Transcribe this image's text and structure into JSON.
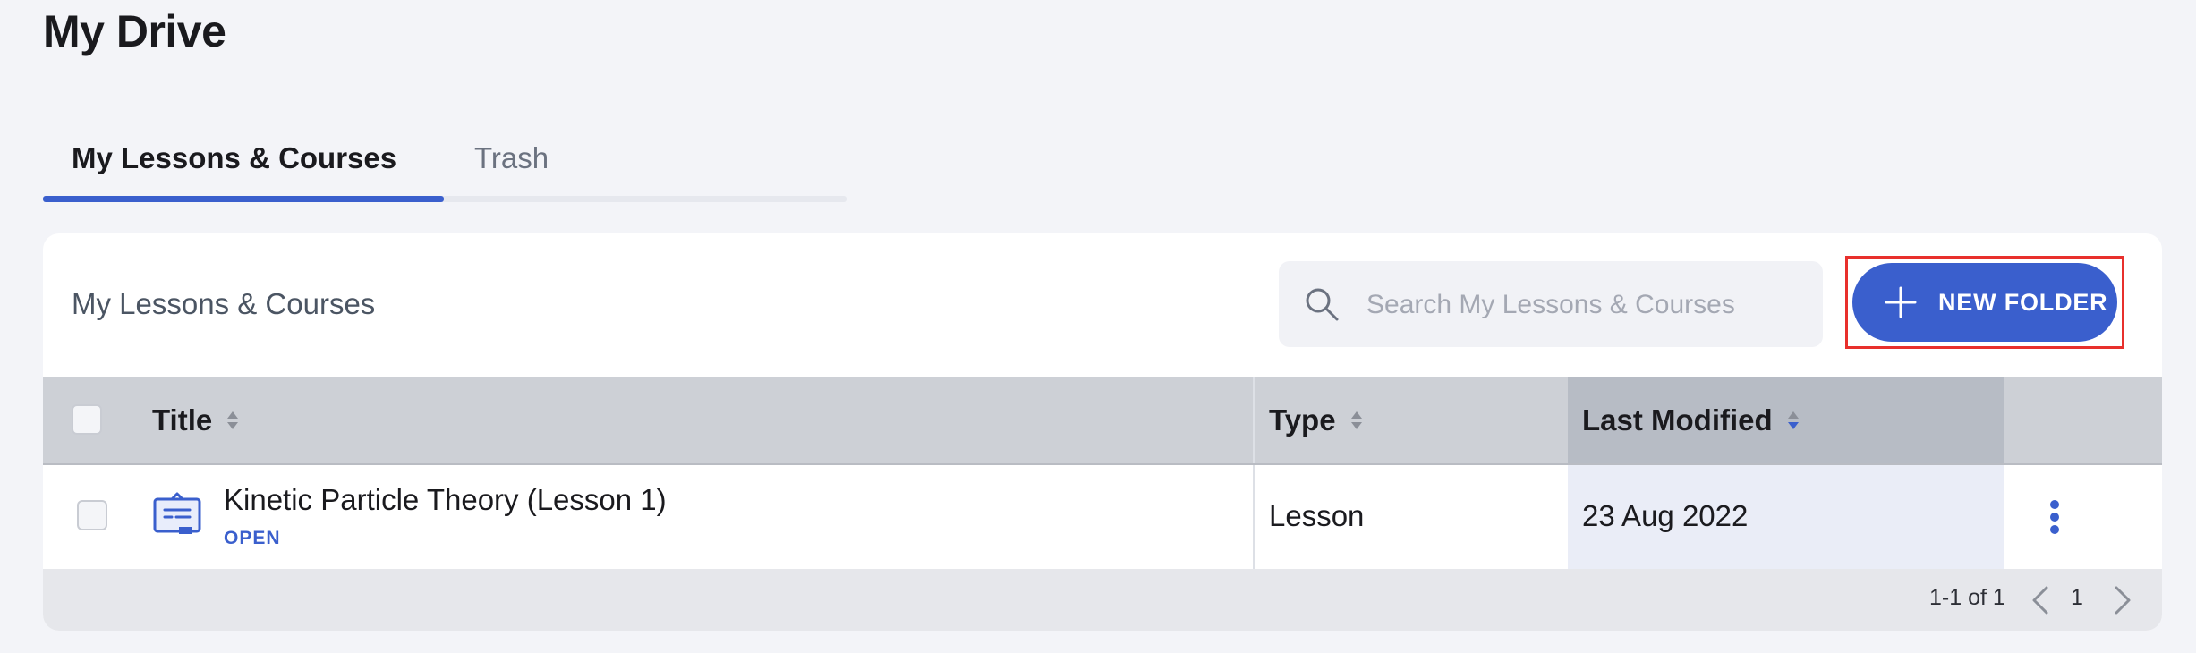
{
  "page": {
    "title": "My Drive"
  },
  "tabs": [
    {
      "label": "My Lessons & Courses",
      "active": true
    },
    {
      "label": "Trash",
      "active": false
    }
  ],
  "card": {
    "title": "My Lessons & Courses",
    "search": {
      "placeholder": "Search My Lessons & Courses",
      "value": ""
    },
    "new_folder_label": "NEW FOLDER"
  },
  "table": {
    "headers": {
      "title": "Title",
      "type": "Type",
      "last_modified": "Last Modified"
    },
    "sorted_column": "last_modified",
    "rows": [
      {
        "title": "Kinetic Particle Theory (Lesson 1)",
        "action": "OPEN",
        "type": "Lesson",
        "last_modified": "23 Aug 2022",
        "icon": "lesson-board-icon"
      }
    ]
  },
  "pagination": {
    "range": "1-1 of 1",
    "page": "1"
  },
  "colors": {
    "accent": "#3a5fcd",
    "highlight_border": "#e8302c",
    "sorted_header": "#b7bcc5",
    "sorted_cell": "#eaedf7"
  }
}
